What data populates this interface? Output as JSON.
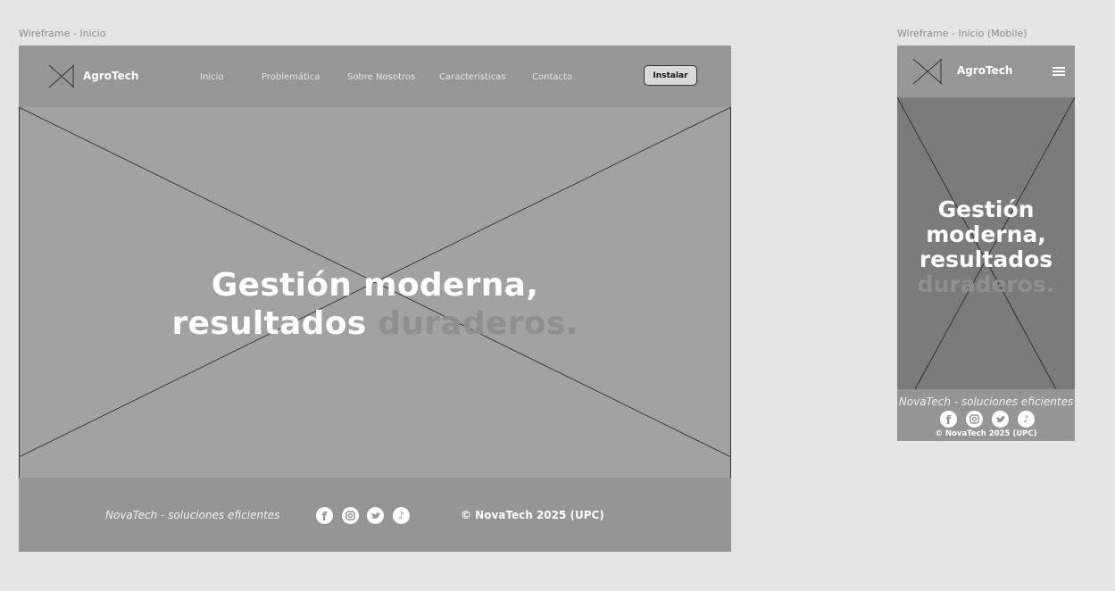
{
  "desktop": {
    "frame_label": "Wireframe - Inicio",
    "brand": "AgroTech",
    "nav": [
      "Inicio",
      "Problemática",
      "Sobre Nosotros",
      "Características",
      "Contacto"
    ],
    "install_label": "Instalar",
    "headline_line1": "Gestión moderna,",
    "headline_line2_bright": "resultados",
    "headline_line2_muted": "duraderos.",
    "tagline": "NovaTech - soluciones eficientes",
    "copyright": "© NovaTech 2025 (UPC)",
    "social_icons": [
      "facebook-icon",
      "instagram-icon",
      "twitter-icon",
      "tiktok-icon"
    ]
  },
  "mobile": {
    "frame_label": "Wireframe - Inicio (Mobile)",
    "brand": "AgroTech",
    "headline_line1": "Gestión",
    "headline_line2": "moderna,",
    "headline_line3": "resultados",
    "headline_line4_muted": "duraderos.",
    "tagline": "NovaTech - soluciones eficientes",
    "copyright": "© NovaTech 2025 (UPC)",
    "social_icons": [
      "facebook-icon",
      "instagram-icon",
      "twitter-icon",
      "tiktok-icon"
    ]
  },
  "colors": {
    "canvas": "#e5e5e5",
    "frame": "#969696",
    "hero_desktop": "#a2a2a2",
    "hero_mobile": "#7b7b7b",
    "muted_text": "#8f8f8f",
    "button": "#d9d9d9"
  }
}
